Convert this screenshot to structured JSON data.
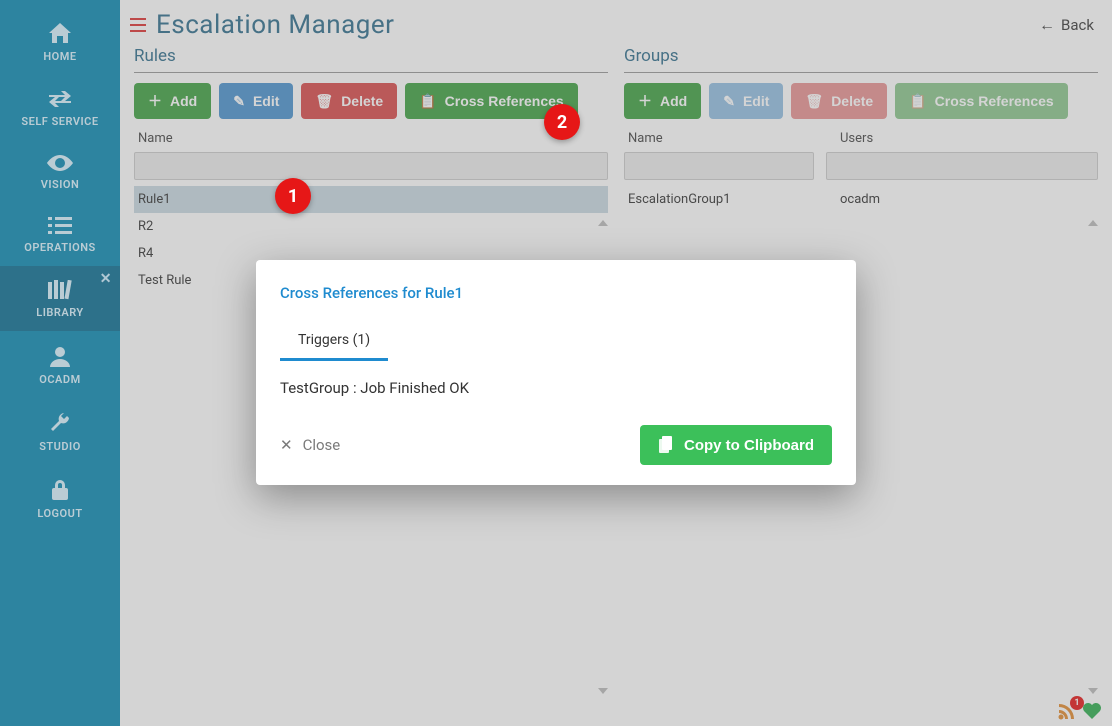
{
  "page": {
    "title": "Escalation Manager",
    "back_label": "Back"
  },
  "sidebar": {
    "items": [
      {
        "label": "HOME"
      },
      {
        "label": "SELF SERVICE"
      },
      {
        "label": "VISION"
      },
      {
        "label": "OPERATIONS"
      },
      {
        "label": "LIBRARY"
      },
      {
        "label": "OCADM"
      },
      {
        "label": "STUDIO"
      },
      {
        "label": "LOGOUT"
      }
    ]
  },
  "buttons": {
    "add": "Add",
    "edit": "Edit",
    "delete": "Delete",
    "xref": "Cross References",
    "close": "Close",
    "copy": "Copy to Clipboard"
  },
  "rules": {
    "title": "Rules",
    "header": {
      "name": "Name"
    },
    "rows": [
      {
        "name": "Rule1",
        "selected": true
      },
      {
        "name": "R2"
      },
      {
        "name": "R4"
      },
      {
        "name": "Test Rule"
      }
    ]
  },
  "groups": {
    "title": "Groups",
    "header": {
      "name": "Name",
      "users": "Users"
    },
    "rows": [
      {
        "name": "EscalationGroup1",
        "users": "ocadm"
      }
    ]
  },
  "modal": {
    "title": "Cross References for Rule1",
    "tab": "Triggers (1)",
    "body": "TestGroup : Job Finished OK"
  },
  "callouts": {
    "one": "1",
    "two": "2"
  },
  "status": {
    "rss_count": "1"
  }
}
